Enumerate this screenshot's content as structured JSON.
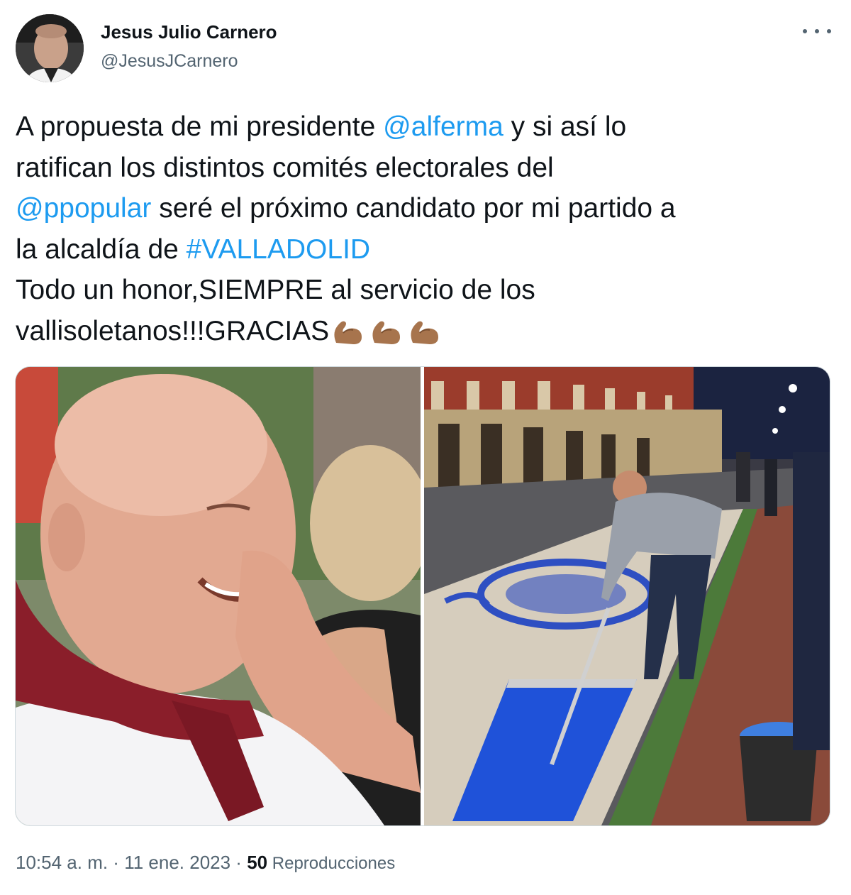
{
  "author": {
    "name": "Jesus Julio Carnero",
    "handle": "@JesusJCarnero",
    "avatar_icon": "profile-photo-avatar"
  },
  "more_icon": "more-dots-icon",
  "tweet": {
    "t1": "A propuesta de mi presidente ",
    "mention1": "@alferma",
    "t2": " y si así lo\nratifican los distintos comités electorales del\n",
    "mention2": "@ppopular",
    "t3": " seré el próximo candidato por mi partido a\nla alcaldía de ",
    "hashtag": "#VALLADOLID",
    "t4": "\nTodo un honor,SIEMPRE al servicio de los\nvallisoletanos!!!GRACIAS",
    "emoji": [
      "flexed-biceps-icon",
      "flexed-biceps-icon",
      "flexed-biceps-icon"
    ]
  },
  "media": [
    {
      "name": "photo-smiling-man-red-scarf"
    },
    {
      "name": "photo-man-painting-sand-carpet-at-night"
    }
  ],
  "meta": {
    "time": "10:54 a. m.",
    "sep1": " · ",
    "date": "11 ene. 2023",
    "sep2": " · ",
    "views_count": "50",
    "views_label": " Reproducciones"
  },
  "colors": {
    "link": "#1d9bf0",
    "text": "#0f1419",
    "secondary": "#536471"
  }
}
